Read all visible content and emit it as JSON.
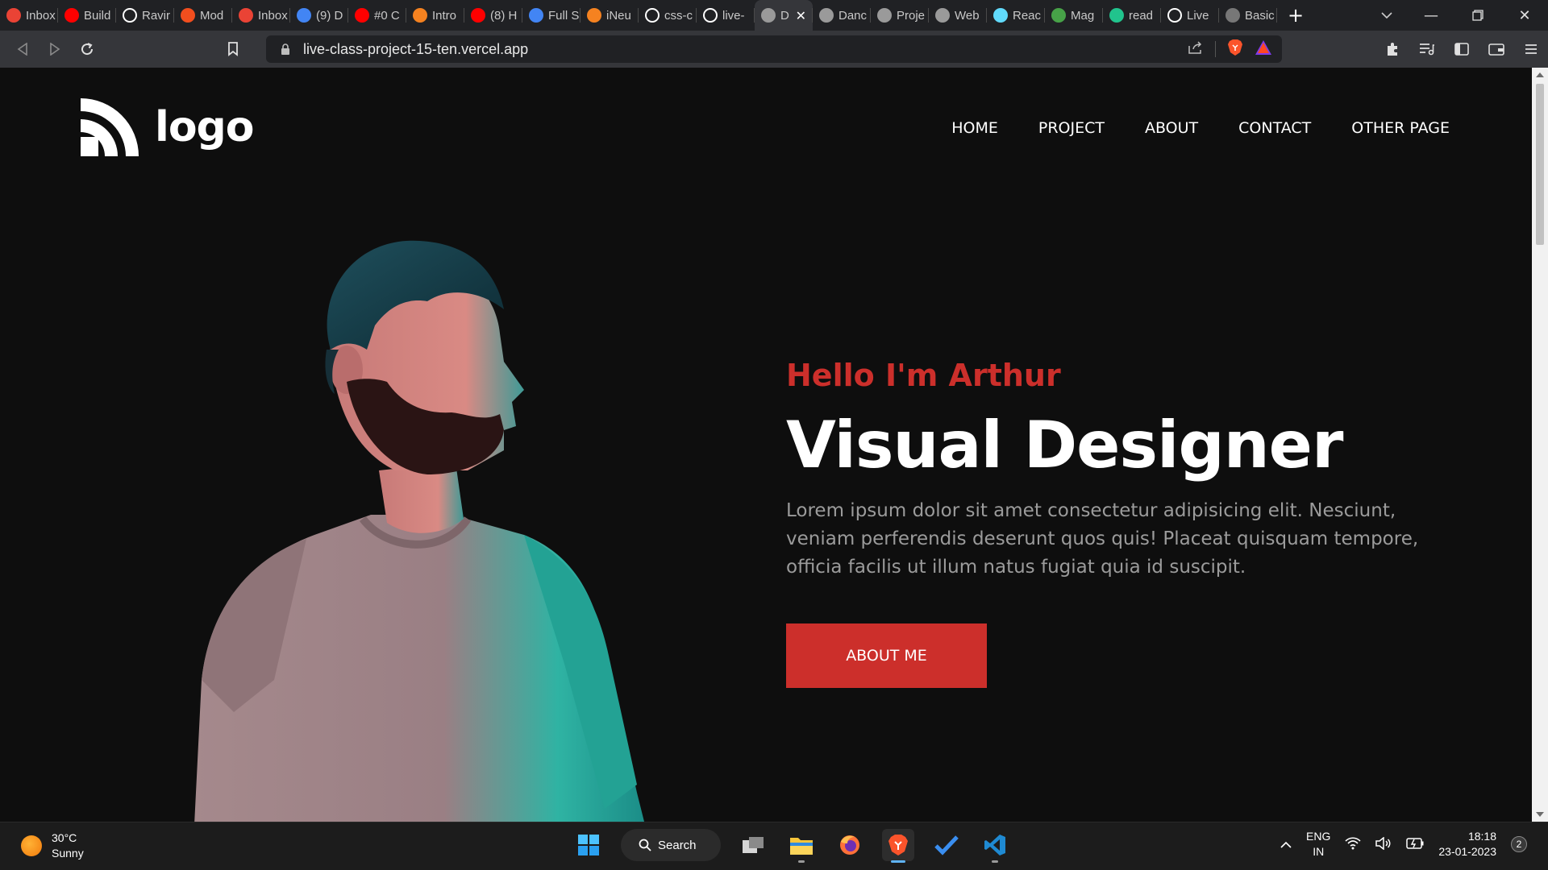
{
  "browser": {
    "tabs": [
      {
        "title": "Inbox",
        "favicon": "gmail-icon",
        "color": "#ea4335"
      },
      {
        "title": "Build",
        "favicon": "youtube-icon",
        "color": "#ff0000"
      },
      {
        "title": "Ravir",
        "favicon": "github-icon",
        "color": "#ffffff"
      },
      {
        "title": "Mod",
        "favicon": "figma-icon",
        "color": "#f24e1e"
      },
      {
        "title": "Inbox",
        "favicon": "gmail-icon",
        "color": "#ea4335"
      },
      {
        "title": "(9) D",
        "favicon": "chrome-notification-icon",
        "color": "#4285f4"
      },
      {
        "title": "#0 C",
        "favicon": "youtube-icon",
        "color": "#ff0000"
      },
      {
        "title": "Intro",
        "favicon": "ineuron-icon",
        "color": "#f58220"
      },
      {
        "title": "(8) H",
        "favicon": "youtube-icon",
        "color": "#ff0000"
      },
      {
        "title": "Full S",
        "favicon": "docs-icon",
        "color": "#4285f4"
      },
      {
        "title": "iNeu",
        "favicon": "ineuron-icon",
        "color": "#f58220"
      },
      {
        "title": "css-c",
        "favicon": "github-icon",
        "color": "#ffffff"
      },
      {
        "title": "live-",
        "favicon": "vercel-icon",
        "color": "#ffffff"
      },
      {
        "title": "D",
        "favicon": "globe-icon",
        "color": "#9a9a9a",
        "active": true
      },
      {
        "title": "Danc",
        "favicon": "globe-icon",
        "color": "#9a9a9a"
      },
      {
        "title": "Proje",
        "favicon": "globe-icon",
        "color": "#9a9a9a"
      },
      {
        "title": "Web",
        "favicon": "globe-icon",
        "color": "#9a9a9a"
      },
      {
        "title": "Reac",
        "favicon": "react-icon",
        "color": "#61dafb"
      },
      {
        "title": "Mag",
        "favicon": "mongodb-icon",
        "color": "#47a248"
      },
      {
        "title": "read",
        "favicon": "app-icon",
        "color": "#21c48d"
      },
      {
        "title": "Live",
        "favicon": "page-icon",
        "color": "#ffffff"
      },
      {
        "title": "Basic",
        "favicon": "markdown-icon",
        "color": "#777777"
      }
    ],
    "url": "live-class-project-15-ten.vercel.app"
  },
  "site": {
    "logo_text": "logo",
    "nav": [
      "HOME",
      "PROJECT",
      "ABOUT",
      "CONTACT",
      "OTHER PAGE"
    ],
    "hero": {
      "greeting": "Hello I'm Arthur",
      "title": "Visual Designer",
      "description": "Lorem ipsum dolor sit amet consectetur adipisicing elit. Nesciunt, veniam perferendis deserunt quos quis! Placeat quisquam tempore, officia facilis ut illum natus fugiat quia id suscipit.",
      "cta": "ABOUT ME"
    },
    "colors": {
      "accent": "#cc2f2b",
      "background": "#0e0e0e"
    }
  },
  "taskbar": {
    "weather": {
      "temp": "30°C",
      "condition": "Sunny"
    },
    "search_label": "Search",
    "lang": {
      "line1": "ENG",
      "line2": "IN"
    },
    "clock": {
      "time": "18:18",
      "date": "23-01-2023"
    },
    "notifications": "2"
  }
}
